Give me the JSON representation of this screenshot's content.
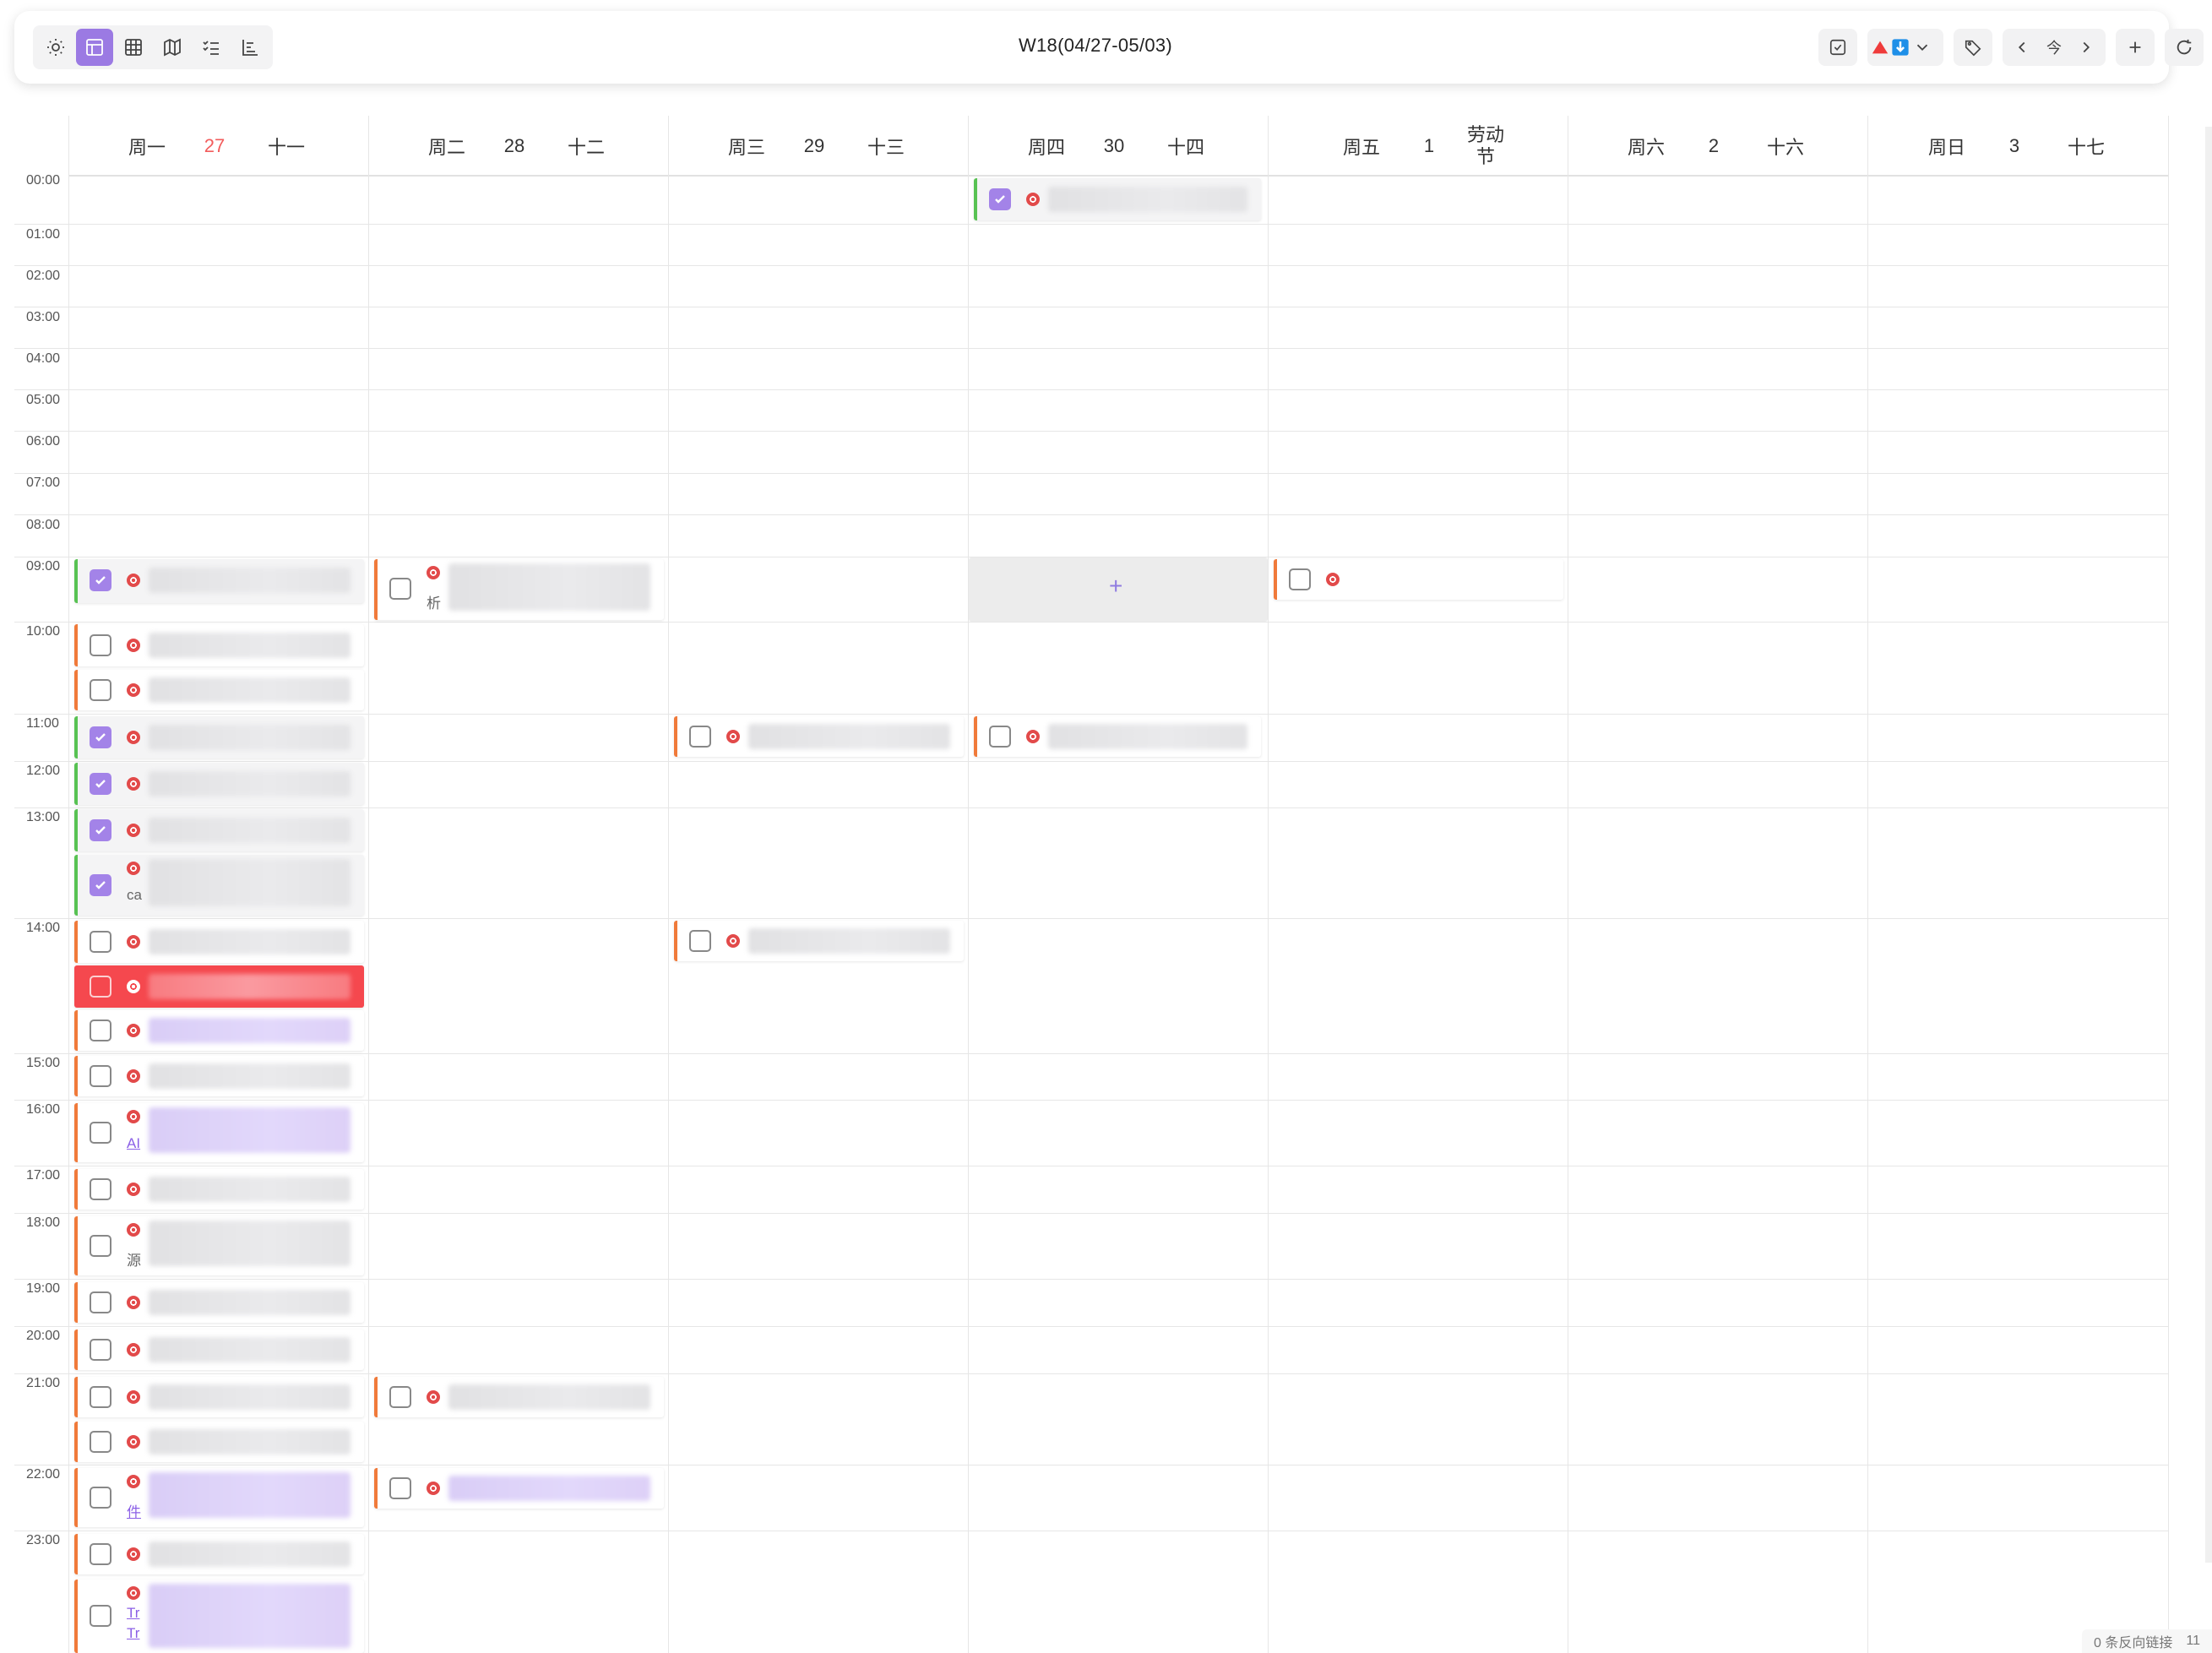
{
  "toolbar": {
    "title": "W18(04/27-05/03)",
    "left_icons": [
      "sun-icon",
      "layout-icon",
      "grid-icon",
      "map-icon",
      "checklist-icon",
      "gantt-icon"
    ],
    "today_label": "今",
    "colors": {
      "accent": "#9b7ae3"
    }
  },
  "days": [
    {
      "week": "周一",
      "num": "27",
      "lunar": "十一",
      "today": true
    },
    {
      "week": "周二",
      "num": "28",
      "lunar": "十二"
    },
    {
      "week": "周三",
      "num": "29",
      "lunar": "十三"
    },
    {
      "week": "周四",
      "num": "30",
      "lunar": "十四"
    },
    {
      "week": "周五",
      "num": "1",
      "lunar": "劳动节"
    },
    {
      "week": "周六",
      "num": "2",
      "lunar": "十六"
    },
    {
      "week": "周日",
      "num": "3",
      "lunar": "十七"
    }
  ],
  "hours": [
    "00:00",
    "01:00",
    "02:00",
    "03:00",
    "04:00",
    "05:00",
    "06:00",
    "07:00",
    "08:00",
    "09:00",
    "10:00",
    "11:00",
    "12:00",
    "13:00",
    "14:00",
    "15:00",
    "16:00",
    "17:00",
    "18:00",
    "19:00",
    "20:00",
    "21:00",
    "22:00",
    "23:00"
  ],
  "event_tails": {
    "tue_0900": "析",
    "mon_1300b": "ca",
    "mon_1600": "AI",
    "mon_1800": "源",
    "mon_2200": "件",
    "mon_2300b1": "Tr",
    "mon_2300b2": "Tr"
  },
  "footer": {
    "backlinks": "0 条反向链接",
    "count": "11"
  },
  "status_colors": {
    "done": "#58c253",
    "todo": "#f07a3a",
    "overdue": "#f5484e"
  }
}
